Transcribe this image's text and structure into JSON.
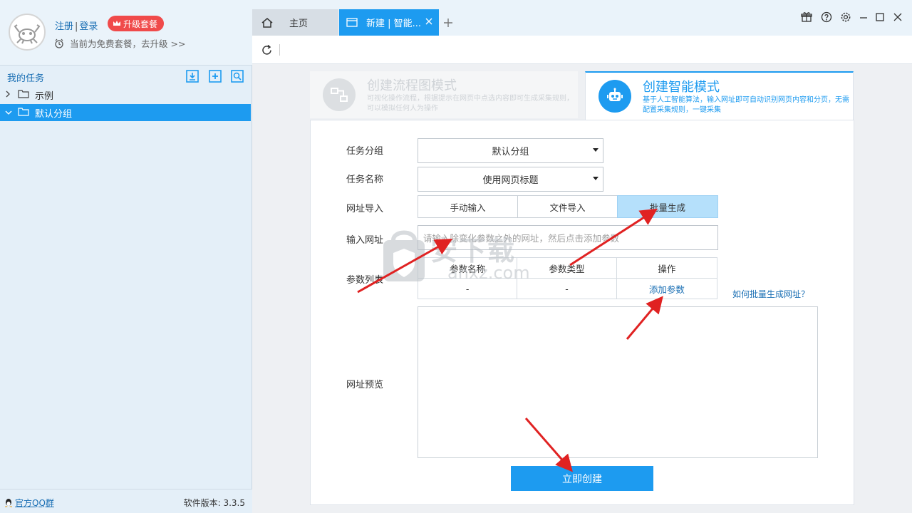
{
  "sidebar": {
    "auth": {
      "register": "注册",
      "separator": "|",
      "login": "登录"
    },
    "upgrade_label": "升级套餐",
    "plan_text": "当前为免费套餐，去升级 >>",
    "tasks_title": "我的任务",
    "tree": [
      {
        "label": "示例",
        "expanded": false,
        "active": false
      },
      {
        "label": "默认分组",
        "expanded": true,
        "active": true
      }
    ],
    "footer": {
      "qq_group": "官方QQ群",
      "version": "软件版本: 3.3.5"
    }
  },
  "tabs": [
    {
      "label": "主页",
      "icon": "home-icon",
      "active": false
    },
    {
      "label": "新建 | 智能...",
      "icon": "window-icon",
      "active": true,
      "closable": true
    }
  ],
  "modes": {
    "flow": {
      "title": "创建流程图模式",
      "desc": "可视化操作流程，根据提示在网页中点选内容即可生成采集规则，可以模拟任何人为操作"
    },
    "smart": {
      "title": "创建智能模式",
      "desc": "基于人工智能算法，输入网址即可自动识别网页内容和分页，无需配置采集规则，一键采集"
    }
  },
  "form": {
    "group_label": "任务分组",
    "group_value": "默认分组",
    "name_label": "任务名称",
    "name_value": "使用网页标题",
    "import_label": "网址导入",
    "import_options": [
      "手动输入",
      "文件导入",
      "批量生成"
    ],
    "import_active": 2,
    "url_label": "输入网址",
    "url_placeholder": "请输入除变化参数之外的网址，然后点击添加参数",
    "params_label": "参数列表",
    "params_headers": [
      "参数名称",
      "参数类型",
      "操作"
    ],
    "params_row": [
      "-",
      "-",
      "添加参数"
    ],
    "howto_link": "如何批量生成网址？",
    "preview_label": "网址预览",
    "create_button": "立即创建"
  },
  "watermark": {
    "text": "安下载",
    "sub": "anxz.com"
  },
  "colors": {
    "accent": "#1d9bf0",
    "upgrade": "#f04a4a",
    "arrow": "#e02222"
  }
}
